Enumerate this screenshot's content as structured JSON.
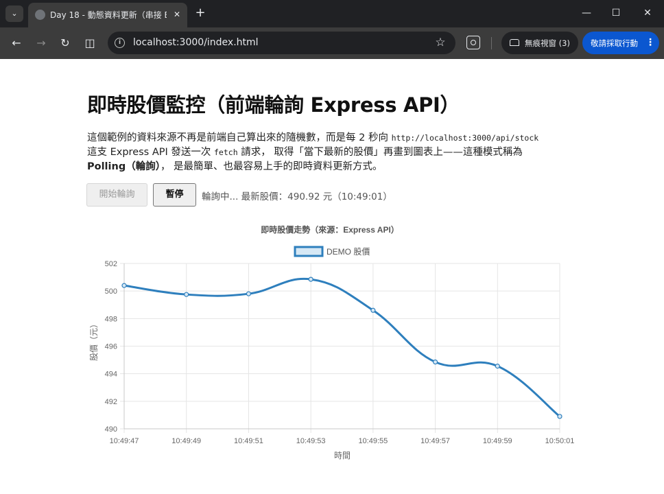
{
  "browser": {
    "tab_title": "Day 18 - 動態資料更新（串接 E",
    "url": "localhost:3000/index.html",
    "incognito_label": "無痕視窗 (3)",
    "action_label": "敬請採取行動"
  },
  "page": {
    "title": "即時股價監控（前端輪詢 Express API）",
    "desc_part1": "這個範例的資料來源不再是前端自己算出來的隨機數，而是每 2 秒向 ",
    "desc_code1": "http://localhost:3000/api/stock",
    "desc_part2": "這支 Express API 發送一次 ",
    "desc_code2": "fetch",
    "desc_part3": " 請求， 取得「當下最新的股價」再畫到圖表上——這種模式稱為",
    "desc_bold": "Polling（輪詢）",
    "desc_part4": "， 是最簡單、也最容易上手的即時資料更新方式。",
    "btn_start": "開始輪詢",
    "btn_pause": "暫停",
    "status": "輪詢中... 最新股價：490.92 元（10:49:01）"
  },
  "chart_data": {
    "type": "line",
    "title": "即時股價走勢（來源：Express API）",
    "xlabel": "時間",
    "ylabel": "股價（元）",
    "categories": [
      "10:49:47",
      "10:49:49",
      "10:49:51",
      "10:49:53",
      "10:49:55",
      "10:49:57",
      "10:49:59",
      "10:50:01"
    ],
    "series": [
      {
        "name": "DEMO 股價",
        "values": [
          500.4,
          499.75,
          499.8,
          500.85,
          498.6,
          494.85,
          494.55,
          490.9
        ]
      }
    ],
    "ylim": [
      490,
      502
    ],
    "yticks": [
      490,
      492,
      494,
      496,
      498,
      500,
      502
    ],
    "grid": true,
    "legend": "top",
    "line_color": "#2e7fbd",
    "fill_color": "#d6e8f5"
  }
}
